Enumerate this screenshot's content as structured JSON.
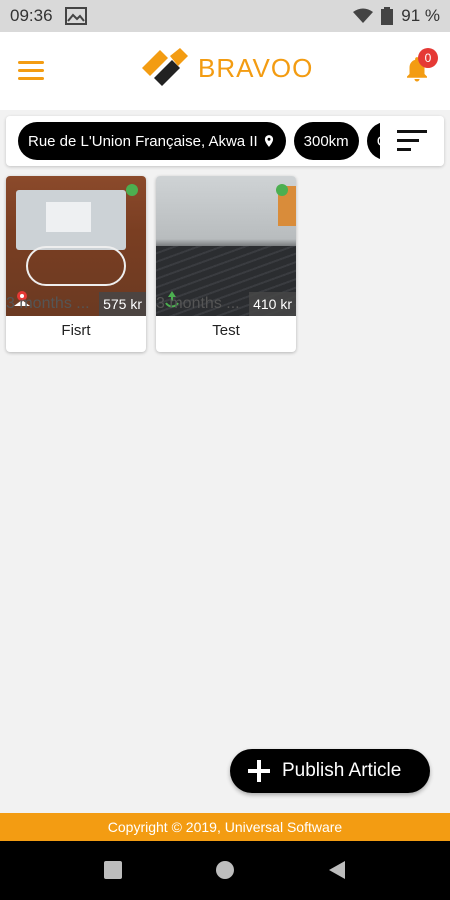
{
  "status_bar": {
    "time": "09:36",
    "battery": "91 %",
    "icons": [
      "image-notification-icon",
      "wifi-icon",
      "battery-icon"
    ]
  },
  "header": {
    "brand": "BRAVOO",
    "notification_count": "0",
    "icons": [
      "hamburger-menu-icon",
      "bell-icon"
    ]
  },
  "filters": {
    "location": "Rue de L'Union Française, Akwa II",
    "distance": "300km",
    "type": "Give-",
    "icons": [
      "location-pin-icon",
      "sort-icon"
    ]
  },
  "articles": [
    {
      "age": "3 months ...",
      "price": "575 kr",
      "title": "Fisrt",
      "status": "available"
    },
    {
      "age": "3 months ...",
      "price": "410 kr",
      "title": "Test",
      "status": "available"
    }
  ],
  "fab": {
    "label": "Publish Article",
    "icon": "plus-icon"
  },
  "footer": {
    "copyright": "Copyright © 2019, Universal Software"
  },
  "nav": {
    "icons": [
      "recent-apps-icon",
      "home-icon",
      "back-icon"
    ]
  },
  "colors": {
    "accent": "#f39c12",
    "status_green": "#4caf50",
    "badge_red": "#e53935"
  }
}
